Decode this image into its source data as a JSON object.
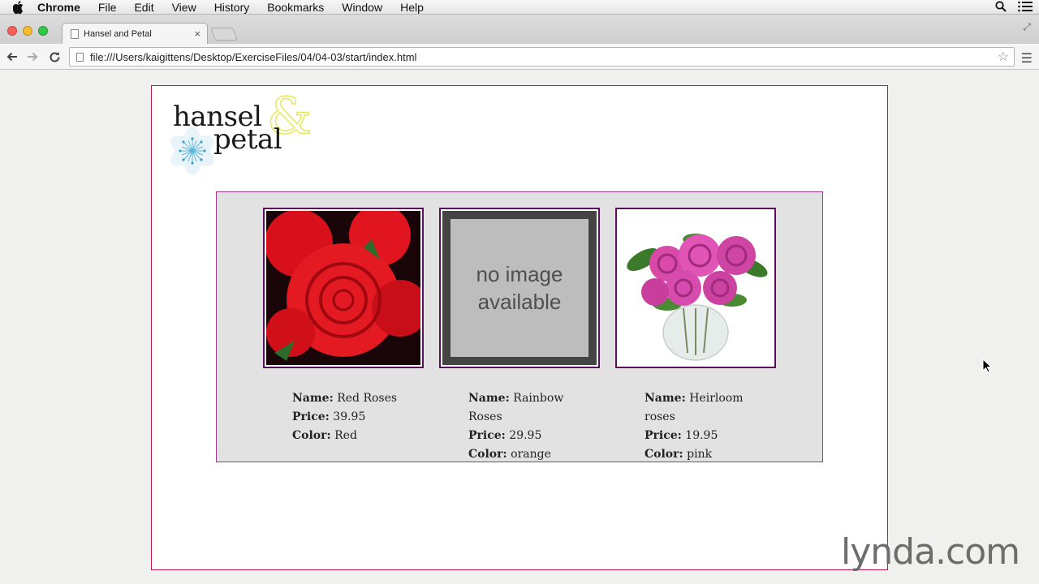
{
  "menubar": {
    "items": [
      "Chrome",
      "File",
      "Edit",
      "View",
      "History",
      "Bookmarks",
      "Window",
      "Help"
    ]
  },
  "tab": {
    "title": "Hansel and Petal"
  },
  "toolbar": {
    "url": "file:///Users/kaigittens/Desktop/ExerciseFiles/04/04-03/start/index.html"
  },
  "logo": {
    "line1": "hansel",
    "line2": "petal",
    "amp": "&"
  },
  "labels": {
    "name": "Name:",
    "price": "Price:",
    "color": "Color:"
  },
  "products": [
    {
      "name": "Red Roses",
      "price": "39.95",
      "color": "Red"
    },
    {
      "name": "Rainbow Roses",
      "price": "29.95",
      "color": "orange"
    },
    {
      "name": "Heirloom roses",
      "price": "19.95",
      "color": "pink"
    }
  ],
  "no_image": {
    "line1": "no image",
    "line2": "available"
  },
  "watermark": "lynda.com",
  "colors": {
    "page_border": "#c01850",
    "panel_border": "#a3348e",
    "frame_border": "#5a0f5a"
  }
}
